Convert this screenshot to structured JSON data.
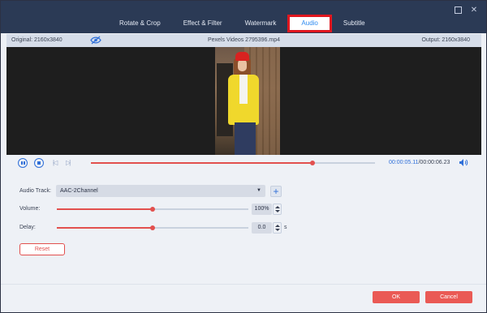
{
  "window": {
    "close_glyph": "✕",
    "restore_glyph": ""
  },
  "tabs": [
    {
      "label": "Rotate & Crop"
    },
    {
      "label": "Effect & Filter"
    },
    {
      "label": "Watermark"
    },
    {
      "label": "Audio",
      "active": true
    },
    {
      "label": "Subtitle"
    }
  ],
  "infobar": {
    "original": "Original: 2160x3840",
    "filename": "Pexels Videos 2795396.mp4",
    "output": "Output: 2160x3840",
    "eye_icon": "eye-icon"
  },
  "player": {
    "progress": 0.78,
    "current_time": "00:00:05.11",
    "separator": "/",
    "total_time": "00:00:06.23",
    "pause_icon": "pause-icon",
    "stop_icon": "stop-icon",
    "prev_icon": "skip-previous-icon",
    "next_icon": "skip-next-icon",
    "volume_icon": "speaker-icon",
    "prev_glyph": "|◁",
    "next_glyph": "▷|"
  },
  "audio": {
    "track_label": "Audio Track:",
    "track_value": "AAC-2Channel",
    "caret_glyph": "▼",
    "add_glyph": "+",
    "volume_label": "Volume:",
    "volume_value": "100%",
    "volume_level": 0.5,
    "delay_label": "Delay:",
    "delay_value": "0.0",
    "delay_level": 0.5,
    "delay_unit": "s",
    "reset_label": "Reset"
  },
  "footer": {
    "ok_label": "OK",
    "cancel_label": "Cancel"
  },
  "colors": {
    "accent": "#2f6fd8",
    "brand_red": "#e2504e",
    "titlebar": "#2b3a55"
  }
}
